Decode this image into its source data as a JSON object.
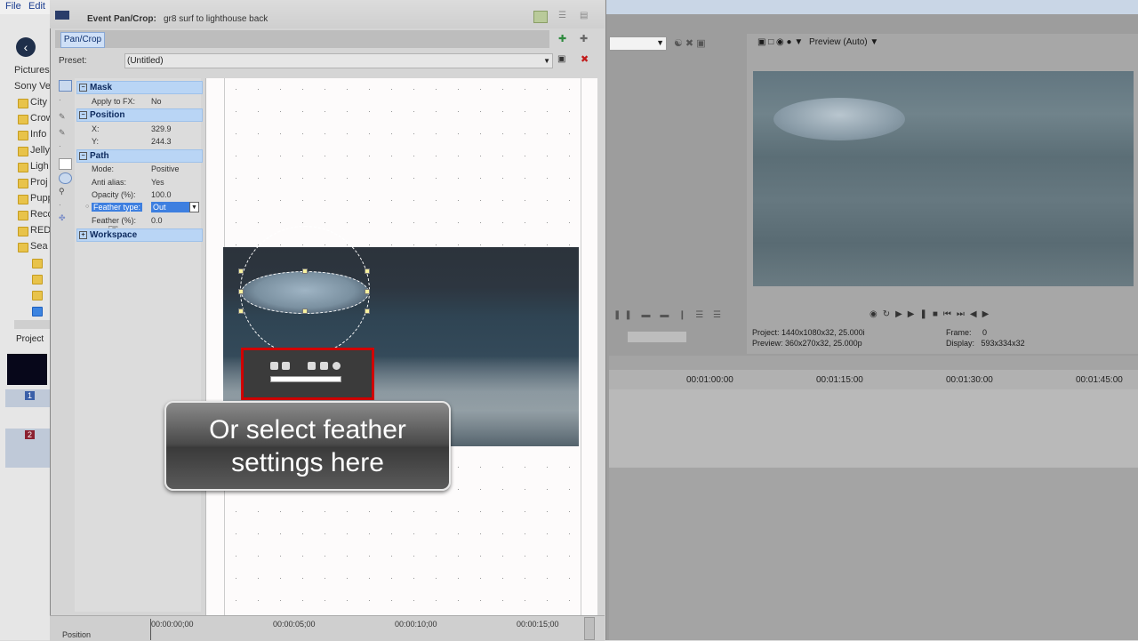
{
  "menubar": {
    "file": "File",
    "edit": "Edit"
  },
  "explorer": {
    "items": [
      "Pictures",
      "Sony Ve",
      "City",
      "Crow",
      "Info",
      "Jelly",
      "Ligh",
      "Proj",
      "Pupp",
      "Reco",
      "RED",
      "Sea"
    ],
    "tab_project": "Project"
  },
  "tracks": {
    "track1": "1",
    "track2": "2"
  },
  "dialog": {
    "title_label": "Event Pan/Crop:",
    "title_event": "gr8 surf to lighthouse back",
    "tab_pancrop": "Pan/Crop",
    "preset_label": "Preset:",
    "preset_value": "(Untitled)"
  },
  "properties": {
    "mask": {
      "header": "Mask",
      "apply_label": "Apply to FX:",
      "apply_value": "No"
    },
    "position": {
      "header": "Position",
      "x_label": "X:",
      "x_value": "329.9",
      "y_label": "Y:",
      "y_value": "244.3"
    },
    "path": {
      "header": "Path",
      "mode_label": "Mode:",
      "mode_value": "Positive",
      "anti_label": "Anti alias:",
      "anti_value": "Yes",
      "opacity_label": "Opacity (%):",
      "opacity_value": "100.0",
      "feather_type_label": "Feather type:",
      "feather_type_value": "Out",
      "feather_pct_label": "Feather (%):",
      "feather_pct_value": "0.0"
    },
    "workspace": {
      "header": "Workspace"
    }
  },
  "callout": {
    "line1": "Or select feather",
    "line2": "settings here"
  },
  "dialog_timeline": {
    "position_label": "Position",
    "ticks": [
      "00:00:00;00",
      "00:00:05;00",
      "00:00:10;00",
      "00:00:15;00"
    ]
  },
  "preview": {
    "mode": "Preview (Auto)",
    "project_label": "Project:",
    "project_value": "1440x1080x32, 25.000i",
    "preview_label": "Preview:",
    "preview_value": "360x270x32, 25.000p",
    "frame_label": "Frame:",
    "frame_value": "0",
    "display_label": "Display:",
    "display_value": "593x334x32"
  },
  "timeline": {
    "ticks": [
      "00:01:00:00",
      "00:01:15:00",
      "00:01:30:00",
      "00:01:45:00"
    ]
  },
  "colors": {
    "accent": "#b9d5f5",
    "callout_border": "#e8e8e8",
    "highlight_red": "#d10000"
  }
}
